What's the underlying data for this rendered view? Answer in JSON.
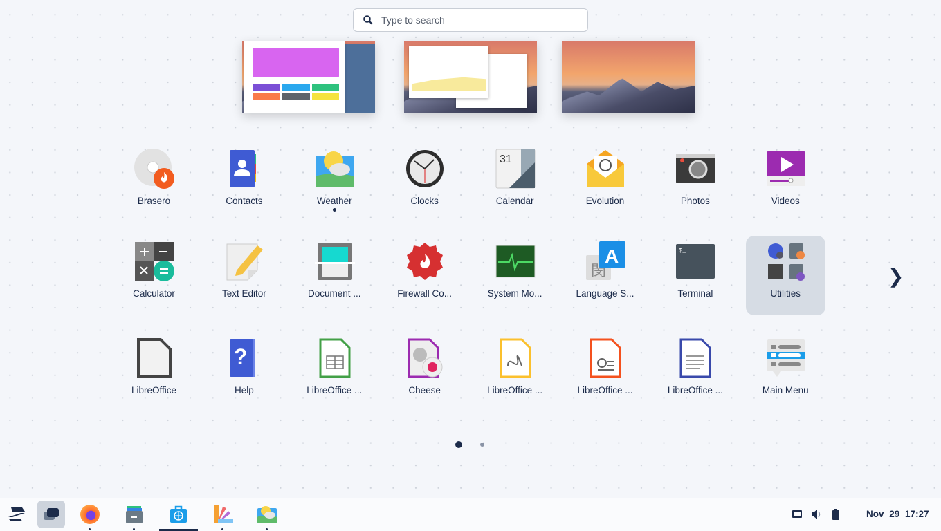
{
  "search": {
    "placeholder": "Type to search",
    "icon": "search-icon"
  },
  "workspaces": [
    {
      "index": 1
    },
    {
      "index": 2
    },
    {
      "index": 3
    }
  ],
  "apps": [
    {
      "label": "Brasero",
      "icon": "brasero-icon"
    },
    {
      "label": "Contacts",
      "icon": "contacts-icon"
    },
    {
      "label": "Weather",
      "icon": "weather-icon",
      "running": true
    },
    {
      "label": "Clocks",
      "icon": "clocks-icon"
    },
    {
      "label": "Calendar",
      "icon": "calendar-icon",
      "badge": "31"
    },
    {
      "label": "Evolution",
      "icon": "evolution-icon"
    },
    {
      "label": "Photos",
      "icon": "photos-icon"
    },
    {
      "label": "Videos",
      "icon": "videos-icon"
    },
    {
      "label": "Calculator",
      "icon": "calculator-icon"
    },
    {
      "label": "Text Editor",
      "icon": "text-editor-icon"
    },
    {
      "label": "Document ...",
      "icon": "document-scanner-icon"
    },
    {
      "label": "Firewall Co...",
      "icon": "firewall-icon"
    },
    {
      "label": "System Mo...",
      "icon": "system-monitor-icon"
    },
    {
      "label": "Language S...",
      "icon": "language-support-icon",
      "badge": "A"
    },
    {
      "label": "Terminal",
      "icon": "terminal-icon",
      "badge": "$_"
    },
    {
      "label": "Utilities",
      "icon": "folder-icon",
      "selected": true
    },
    {
      "label": "LibreOffice",
      "icon": "libreoffice-icon"
    },
    {
      "label": "Help",
      "icon": "help-icon",
      "badge": "?"
    },
    {
      "label": "LibreOffice ...",
      "icon": "libreoffice-calc-icon"
    },
    {
      "label": "Cheese",
      "icon": "cheese-icon"
    },
    {
      "label": "LibreOffice ...",
      "icon": "libreoffice-draw-icon"
    },
    {
      "label": "LibreOffice ...",
      "icon": "libreoffice-impress-icon"
    },
    {
      "label": "LibreOffice ...",
      "icon": "libreoffice-writer-icon"
    },
    {
      "label": "Main Menu",
      "icon": "main-menu-icon"
    }
  ],
  "pagination": {
    "pages": 2,
    "current": 1
  },
  "panel": {
    "apps": [
      {
        "name": "zorin-menu",
        "running": false
      },
      {
        "name": "workspaces",
        "running": false
      },
      {
        "name": "firefox",
        "running": true
      },
      {
        "name": "files",
        "running": true
      },
      {
        "name": "software",
        "running": true,
        "active": true
      },
      {
        "name": "appearance",
        "running": true
      },
      {
        "name": "weather",
        "running": true
      }
    ],
    "date": "Nov 29",
    "time": "17:27"
  },
  "colors": {
    "text": "#1c2b4a",
    "accent": "#1c2b4a",
    "selected_bg": "#d6dce4"
  }
}
